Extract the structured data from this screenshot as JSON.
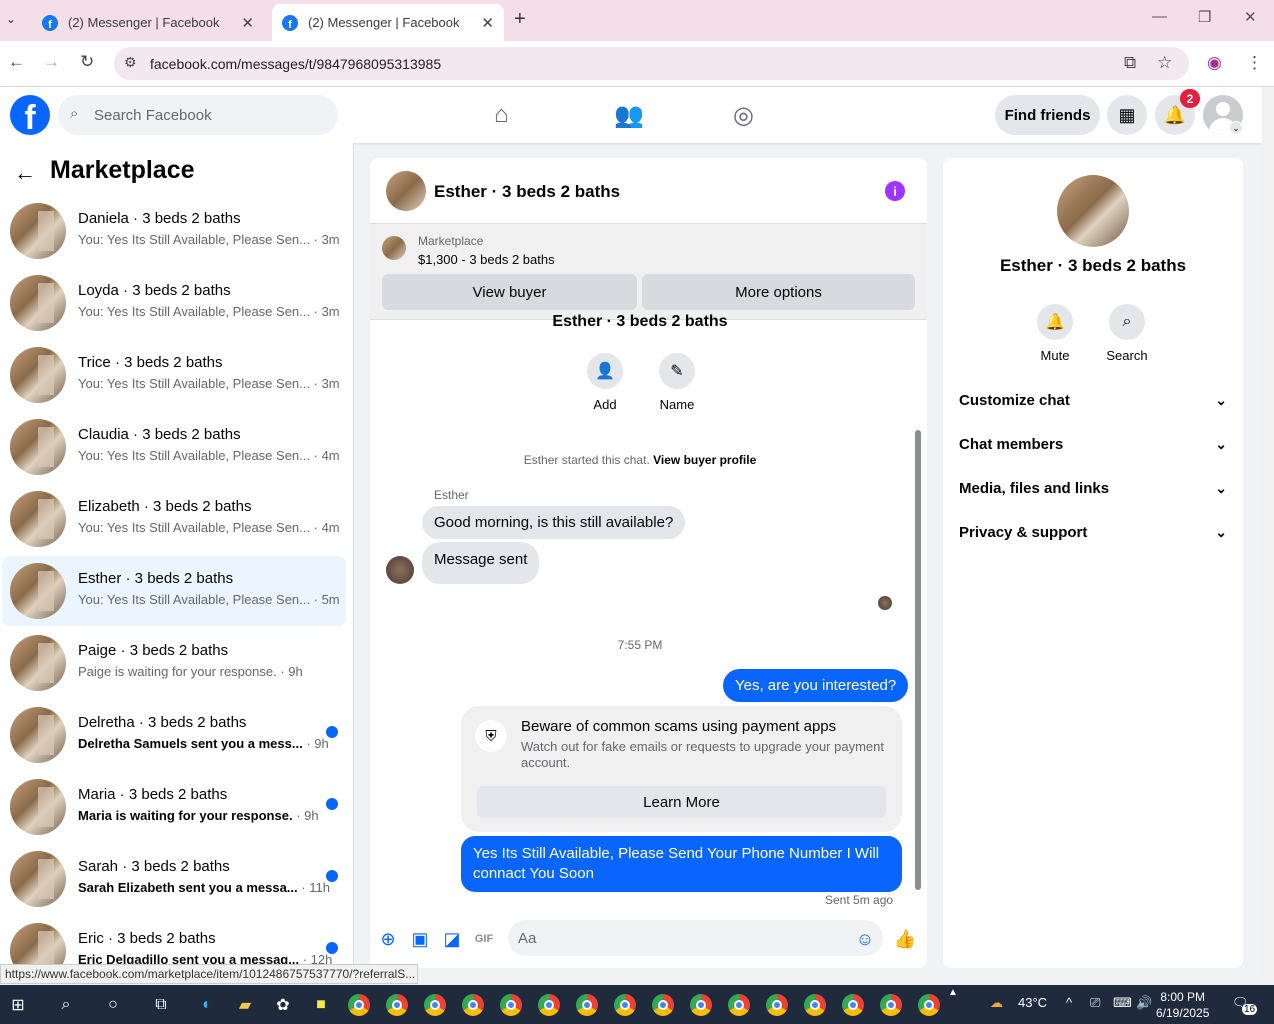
{
  "browser": {
    "tabs": [
      {
        "title": "(2) Messenger | Facebook"
      },
      {
        "title": "(2) Messenger | Facebook"
      }
    ],
    "url": "facebook.com/messages/t/9847968095313985",
    "status_url": "https://www.facebook.com/marketplace/item/1012486757537770/?referralS..."
  },
  "fb_header": {
    "search_placeholder": "Search Facebook",
    "find_friends": "Find friends",
    "notification_count": "2"
  },
  "sidebar": {
    "title": "Marketplace",
    "conversations": [
      {
        "name": "Daniela · 3 beds 2 baths",
        "snippet": "You: Yes Its Still Available, Please Sen...",
        "time": "· 3m",
        "unread": false
      },
      {
        "name": "Loyda · 3 beds 2 baths",
        "snippet": "You: Yes Its Still Available, Please Sen...",
        "time": "· 3m",
        "unread": false
      },
      {
        "name": "Trice · 3 beds 2 baths",
        "snippet": "You: Yes Its Still Available, Please Sen...",
        "time": "· 3m",
        "unread": false
      },
      {
        "name": "Claudia · 3 beds 2 baths",
        "snippet": "You: Yes Its Still Available, Please Sen...",
        "time": "· 4m",
        "unread": false
      },
      {
        "name": "Elizabeth · 3 beds 2 baths",
        "snippet": "You: Yes Its Still Available, Please Sen...",
        "time": "· 4m",
        "unread": false
      },
      {
        "name": "Esther · 3 beds 2 baths",
        "snippet": "You: Yes Its Still Available, Please Sen...",
        "time": "· 5m",
        "unread": false
      },
      {
        "name": "Paige · 3 beds 2 baths",
        "snippet": "Paige is waiting for your response.",
        "time": "· 9h",
        "unread": false
      },
      {
        "name": "Delretha · 3 beds 2 baths",
        "snippet": "Delretha Samuels sent you a mess...",
        "time": "· 9h",
        "unread": true
      },
      {
        "name": "Maria · 3 beds 2 baths",
        "snippet": "Maria is waiting for your response.",
        "time": "· 9h",
        "unread": true
      },
      {
        "name": "Sarah · 3 beds 2 baths",
        "snippet": "Sarah Elizabeth sent you a messa...",
        "time": "· 11h",
        "unread": true
      },
      {
        "name": "Eric · 3 beds 2 baths",
        "snippet": "Eric Delgadillo sent you a messag...",
        "time": "· 12h",
        "unread": true
      }
    ]
  },
  "chat": {
    "title": "Esther · 3 beds 2 baths",
    "marketplace_label": "Marketplace",
    "listing": "$1,300 - 3 beds 2 baths",
    "view_buyer": "View buyer",
    "more_options": "More options",
    "top_name": "Esther · 3 beds 2 baths",
    "add_label": "Add",
    "name_label": "Name",
    "started_text": "Esther started this chat.",
    "view_buyer_profile": "View buyer profile",
    "sender": "Esther",
    "msg_in_1": "Good morning, is this still available?",
    "msg_in_2": "Message sent",
    "timestamp": "7:55 PM",
    "msg_out_1": "Yes, are you interested?",
    "scam_title": "Beware of common scams using payment apps",
    "scam_desc": "Watch out for fake emails or requests to upgrade your payment account.",
    "learn_more": "Learn More",
    "msg_out_2": "Yes Its Still Available, Please Send Your Phone Number I Will connact You Soon",
    "sent_status": "Sent 5m ago",
    "input_placeholder": "Aa"
  },
  "details": {
    "name": "Esther · 3 beds 2 baths",
    "mute": "Mute",
    "search": "Search",
    "sections": [
      "Customize chat",
      "Chat members",
      "Media, files and links",
      "Privacy & support"
    ]
  },
  "taskbar": {
    "weather": "43°C",
    "time": "8:00 PM",
    "date": "6/19/2025",
    "notif_count": "16"
  },
  "colors": {
    "brand": "#0866ff",
    "selected": "#ebf5ff",
    "unread_dot": "#0866ff",
    "info": "#a033ff"
  }
}
